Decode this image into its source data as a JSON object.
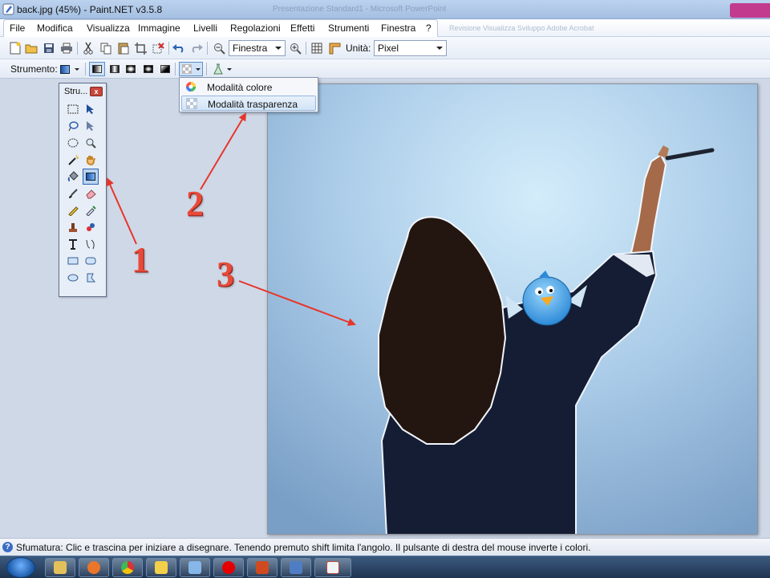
{
  "window": {
    "title": "back.jpg (45%) - Paint.NET v3.5.8",
    "background_title": "Presentazione Standard1 - Microsoft PowerPoint"
  },
  "menu": {
    "items": [
      "File",
      "Modifica",
      "Visualizza",
      "Immagine",
      "Livelli",
      "Regolazioni",
      "Effetti",
      "Strumenti",
      "Finestra",
      "?"
    ],
    "ghost_items": "Revisione     Visualizza     Sviluppo     Adobe Acrobat"
  },
  "toolbar": {
    "zoom_value": "Finestra",
    "units_label": "Unità:",
    "units_value": "Pixel"
  },
  "tool_options": {
    "label": "Strumento:"
  },
  "dropdown": {
    "items": [
      {
        "label": "Modalità colore",
        "icon": "color-wheel-icon"
      },
      {
        "label": "Modalità trasparenza",
        "icon": "checkerboard-icon",
        "highlighted": true
      }
    ]
  },
  "tools_window": {
    "title": "Stru...",
    "close_glyph": "x"
  },
  "annotations": [
    "1",
    "2",
    "3"
  ],
  "status": {
    "icon_glyph": "?",
    "text": "Sfumatura: Clic e trascina per iniziare a disegnare. Tenendo premuto shift limita l'angolo. Il pulsante di destra del mouse inverte i colori."
  },
  "colors": {
    "accent": "#e84a3a",
    "canvas_bg": "#a9c9e6",
    "selection": "#3d7fd0"
  }
}
